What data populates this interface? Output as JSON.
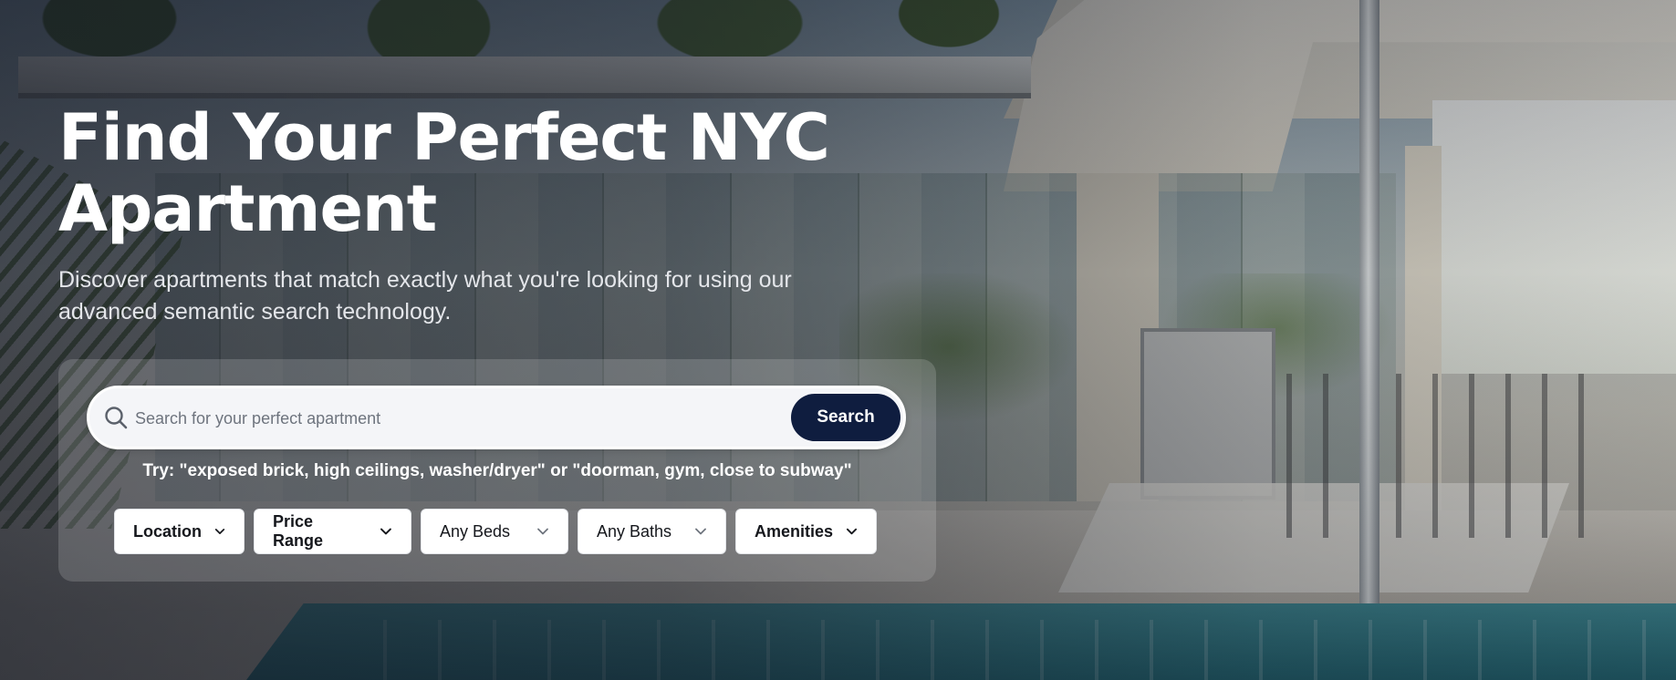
{
  "hero": {
    "title_line1": "Find Your Perfect NYC",
    "title_line2": "Apartment",
    "subtitle": "Discover apartments that match exactly what you're looking for using our advanced semantic search technology."
  },
  "search": {
    "placeholder": "Search for your perfect apartment",
    "value": "",
    "button_label": "Search",
    "hint": "Try: \"exposed brick, high ceilings, washer/dryer\" or \"doorman, gym, close to subway\""
  },
  "filters": [
    {
      "label": "Location",
      "icon": "chevron-down-icon"
    },
    {
      "label": "Price Range",
      "icon": "chevron-down-icon"
    },
    {
      "label": "Any Beds",
      "icon": "chevron-down-icon"
    },
    {
      "label": "Any Baths",
      "icon": "chevron-down-icon"
    },
    {
      "label": "Amenities",
      "icon": "chevron-down-icon"
    }
  ],
  "colors": {
    "search_button_bg": "#0f1d3f",
    "title_text": "#ffffff",
    "panel_bg": "rgba(255,255,255,0.16)"
  }
}
